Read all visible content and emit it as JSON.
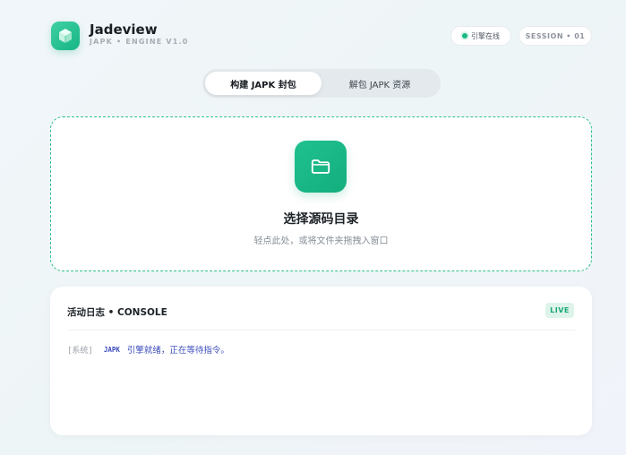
{
  "brand": {
    "name": "Jadeview",
    "subtitle": "JAPK • ENGINE V1.0",
    "logo_icon": "cube-icon"
  },
  "status": {
    "online_label": "引擎在线",
    "session_label": "SESSION • 01"
  },
  "tabs": [
    {
      "label": "构建 JAPK 封包",
      "active": true
    },
    {
      "label": "解包 JAPK 资源",
      "active": false
    }
  ],
  "dropzone": {
    "icon": "folder-icon",
    "title": "选择源码目录",
    "hint": "轻点此处，或将文件夹拖拽入窗口"
  },
  "console": {
    "title": "活动日志 • CONSOLE",
    "badge": "LIVE",
    "lines": [
      {
        "tag": "[系统]",
        "source": "JAPK",
        "message": "引擎就绪，正在等待指令。"
      }
    ]
  },
  "colors": {
    "accent": "#18b884",
    "log_text": "#3d4dbd"
  }
}
